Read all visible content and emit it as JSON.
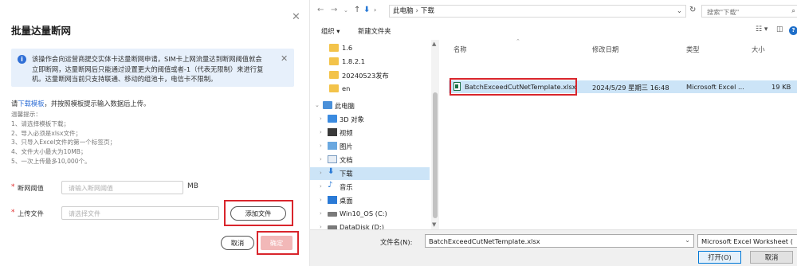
{
  "dialog": {
    "title": "批量达量断网",
    "notice": "该操作会向运营商提交实体卡达量断网申请，SIM卡上网流量达到断网阈值就会立即断网，达量断网后只能通过设置更大的阈值或者-1（代表无限制）来进行复机。达量断网当前只支持联通、移动的组池卡，电信卡不限制。",
    "download_prefix": "请",
    "download_link": "下载模板",
    "download_suffix": "，并按照模板提示输入数据后上传。",
    "tips": [
      "温馨提示：",
      "1、请选择模板下载；",
      "2、导入必须是xlsx文件；",
      "3、只导入Excel文件的第一个标签页；",
      "4、文件大小最大为10MB；",
      "5、一次上传最多10,000个。"
    ],
    "threshold_label": "断网阈值",
    "threshold_placeholder": "请输入断网阈值",
    "threshold_unit": "MB",
    "upload_label": "上传文件",
    "upload_placeholder": "请选择文件",
    "add_file_button": "添加文件",
    "cancel_button": "取消",
    "ok_button": "确定",
    "required_mark": "*"
  },
  "explorer": {
    "address": [
      "此电脑",
      "下载"
    ],
    "search_placeholder": "搜索\"下载\"",
    "toolbar": {
      "organize": "组织 ▾",
      "new_folder": "新建文件夹"
    },
    "tree": [
      {
        "label": "1.6",
        "icon": "folder"
      },
      {
        "label": "1.8.2.1",
        "icon": "folder"
      },
      {
        "label": "20240523发布",
        "icon": "folder"
      },
      {
        "label": "en",
        "icon": "folder"
      },
      {
        "label": "此电脑",
        "icon": "pc"
      },
      {
        "label": "3D 对象",
        "icon": "folder-3d"
      },
      {
        "label": "视频",
        "icon": "video"
      },
      {
        "label": "图片",
        "icon": "picture"
      },
      {
        "label": "文档",
        "icon": "document"
      },
      {
        "label": "下载",
        "icon": "download"
      },
      {
        "label": "音乐",
        "icon": "music"
      },
      {
        "label": "桌面",
        "icon": "desktop"
      },
      {
        "label": "Win10_OS (C:)",
        "icon": "drive"
      },
      {
        "label": "DataDisk (D:)",
        "icon": "drive"
      }
    ],
    "columns": {
      "name": "名称",
      "modified": "修改日期",
      "type": "类型",
      "size": "大小"
    },
    "file": {
      "name": "BatchExceedCutNetTemplate.xlsx",
      "modified": "2024/5/29 星期三 16:48",
      "type": "Microsoft Excel ...",
      "size": "19 KB"
    },
    "footer": {
      "filename_label": "文件名(N):",
      "filename_value": "BatchExceedCutNetTemplate.xlsx",
      "filetype_value": "Microsoft Excel Worksheet (",
      "open_button": "打开(O)",
      "cancel_button": "取消"
    }
  }
}
